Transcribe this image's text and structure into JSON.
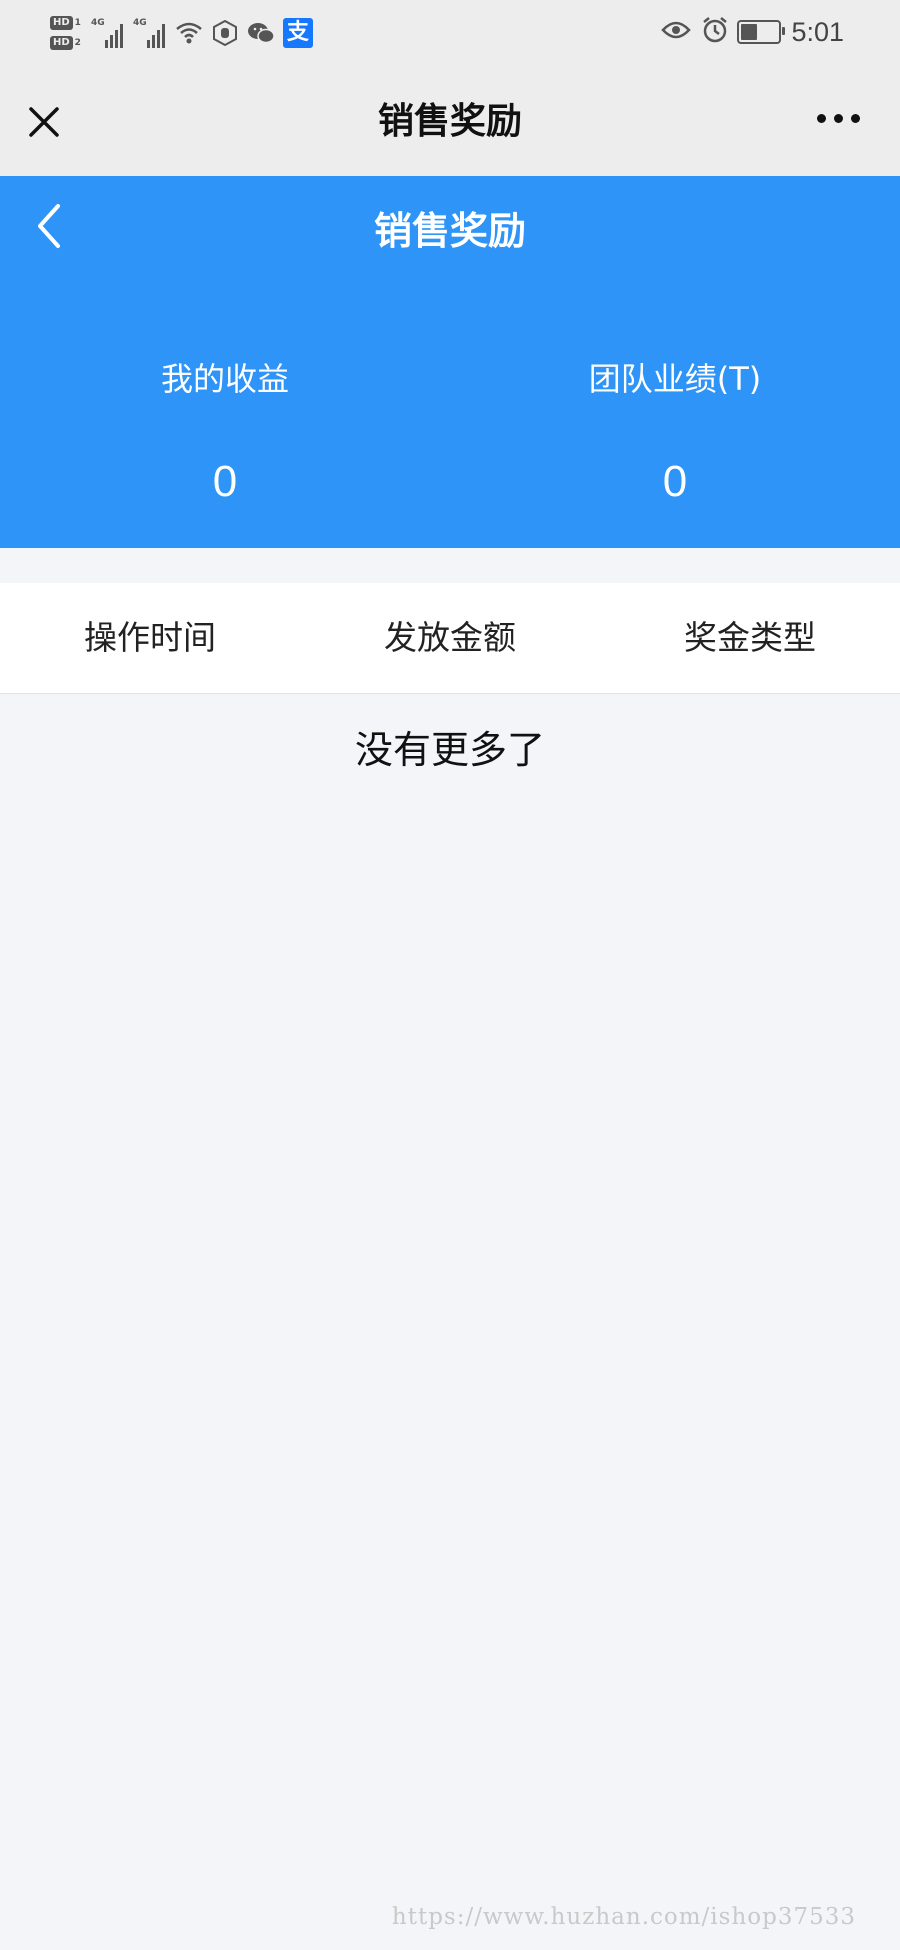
{
  "status_bar": {
    "hd_badges": [
      {
        "label": "HD",
        "num": "1"
      },
      {
        "label": "HD",
        "num": "2"
      }
    ],
    "signals": [
      {
        "tag": "4G"
      },
      {
        "tag": "4G"
      }
    ],
    "icons": [
      "wifi-icon",
      "hand-icon",
      "wechat-icon",
      "alipay-icon"
    ],
    "alipay_glyph": "支",
    "right_icons": [
      "eye-icon",
      "alarm-icon",
      "battery-icon"
    ],
    "time": "5:01"
  },
  "nav_bar": {
    "title": "销售奖励",
    "close_icon": "close-icon",
    "more_icon": "more-icon"
  },
  "hero": {
    "title": "销售奖励",
    "back_icon": "chevron-left-icon",
    "background": "#2e94f8",
    "stats": [
      {
        "label": "我的收益",
        "value": "0"
      },
      {
        "label": "团队业绩(T)",
        "value": "0"
      }
    ]
  },
  "table": {
    "columns": [
      "操作时间",
      "发放金额",
      "奖金类型"
    ],
    "empty_message": "没有更多了"
  },
  "watermark": "https://www.huzhan.com/ishop37533"
}
